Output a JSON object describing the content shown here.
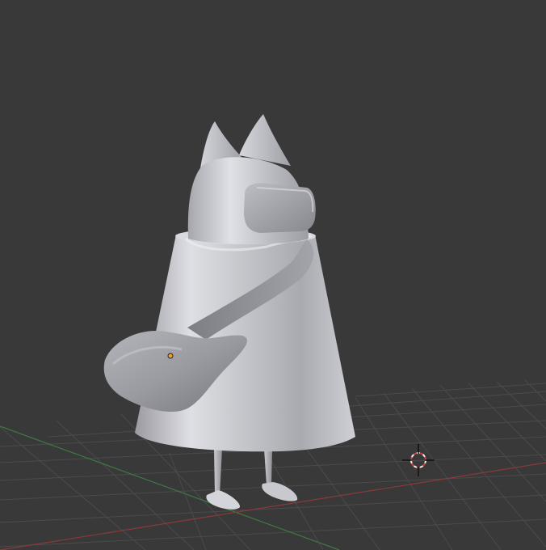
{
  "viewport": {
    "background_color": "#393939",
    "grid_color": "#4b4b4b",
    "x_axis_color": "#8a3a3a",
    "y_axis_color": "#3f7a3f",
    "model": {
      "material_color": "#c8c9cf",
      "shadow_color": "#8c8d93",
      "selected_origin_color": "#f0a030"
    },
    "cursor": {
      "icon": "3d-cursor-icon",
      "ring_colors": [
        "#d04040",
        "#f0f0f0"
      ]
    }
  }
}
